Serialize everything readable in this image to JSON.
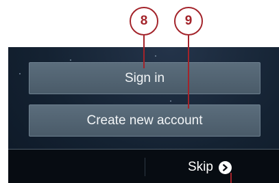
{
  "buttons": {
    "sign_in": "Sign in",
    "create_account": "Create new account"
  },
  "footer": {
    "skip_label": "Skip"
  },
  "callouts": {
    "first": "8",
    "second": "9"
  },
  "colors": {
    "button_bg": "#51626f",
    "screen_bg": "#142232",
    "bottom_bar_bg": "#070c12",
    "callout_red": "#a3232a"
  },
  "icons": {
    "skip": "chevron-right-circle-icon"
  }
}
